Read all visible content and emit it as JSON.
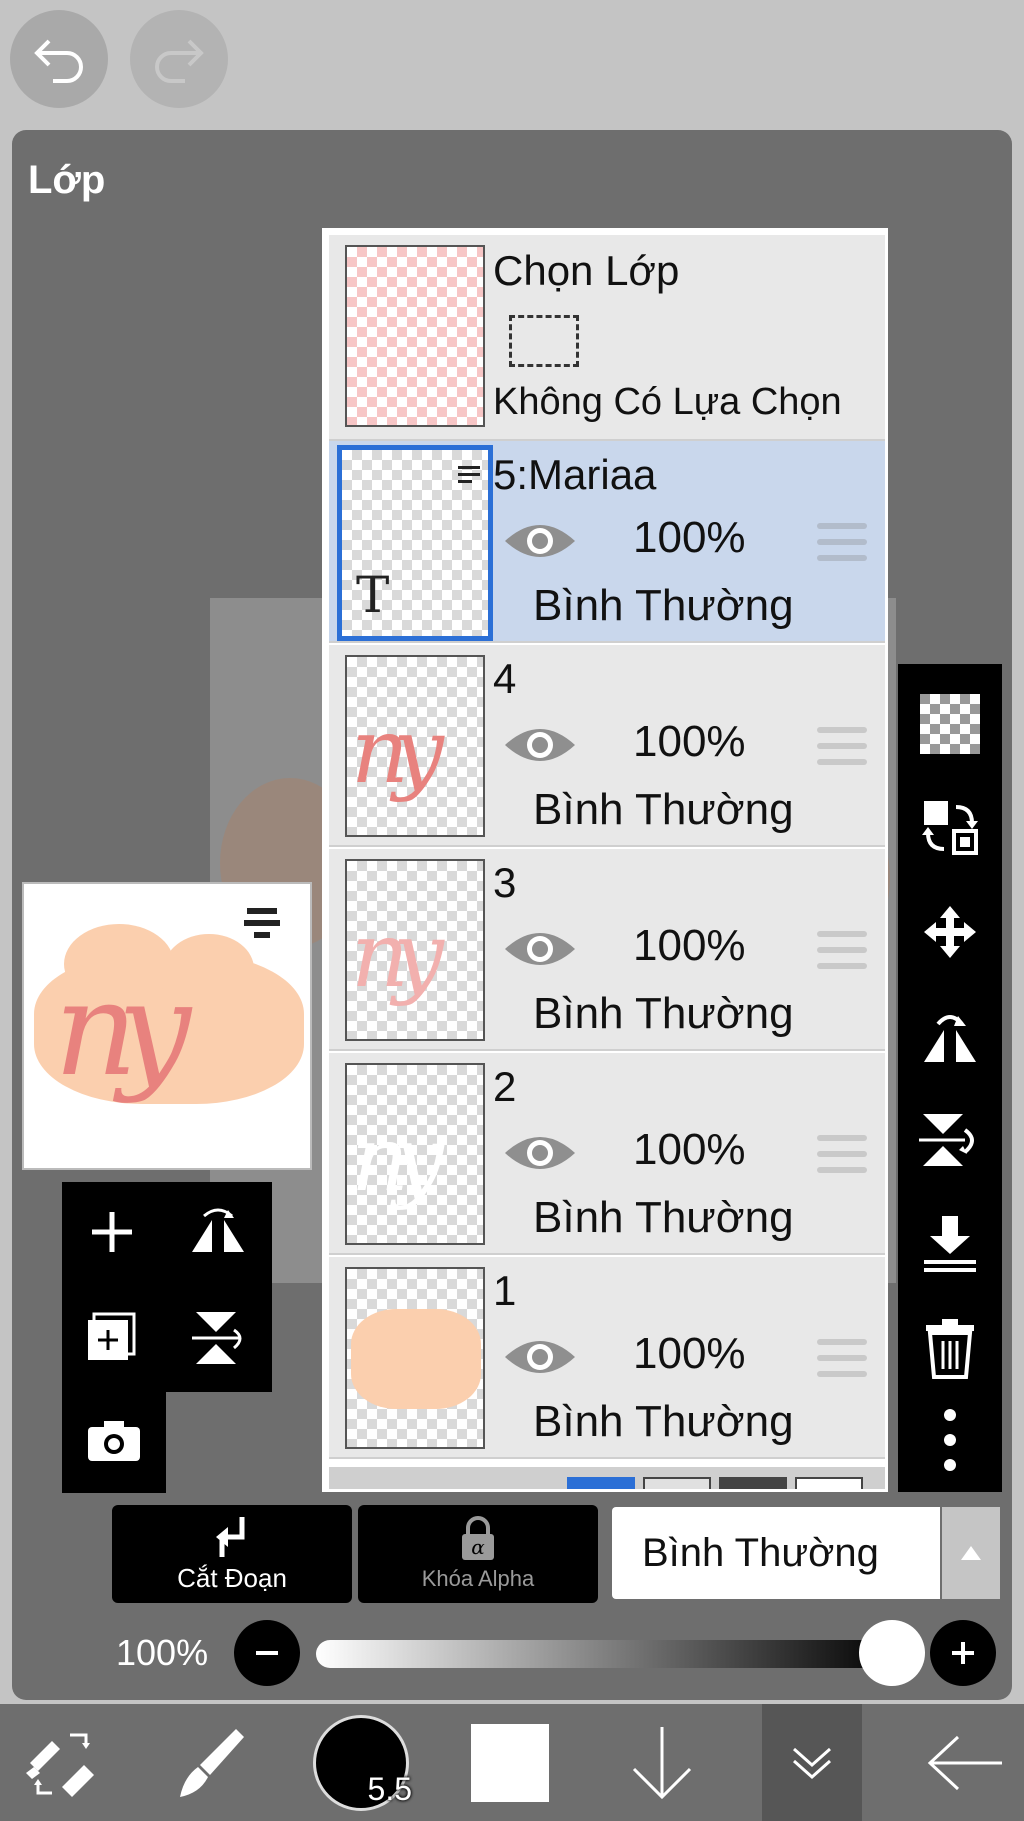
{
  "panel": {
    "title": "Lớp"
  },
  "layer_panel": {
    "selection": {
      "title": "Chọn Lớp",
      "subtitle": "Không Có Lựa Chọn"
    },
    "layers": [
      {
        "name": "5:Mariaa",
        "opacity": "100%",
        "blend": "Bình Thường",
        "selected": true,
        "visible": true,
        "type": "text"
      },
      {
        "name": "4",
        "opacity": "100%",
        "blend": "Bình Thường",
        "selected": false,
        "visible": true
      },
      {
        "name": "3",
        "opacity": "100%",
        "blend": "Bình Thường",
        "selected": false,
        "visible": true
      },
      {
        "name": "2",
        "opacity": "100%",
        "blend": "Bình Thường",
        "selected": false,
        "visible": true
      },
      {
        "name": "1",
        "opacity": "100%",
        "blend": "Bình Thường",
        "selected": false,
        "visible": true
      }
    ]
  },
  "controls": {
    "clip_label": "Cắt Đoạn",
    "alpha_lock_label": "Khóa Alpha",
    "blend_mode": "Bình Thường",
    "opacity_label": "100%",
    "opacity_value": 1.0
  },
  "toolbar": {
    "brush_size": "5.5"
  },
  "colors": {
    "accent": "#2b6fd6",
    "selected_row": "#c9d7ec",
    "panel_bg": "#6e6e6e",
    "peach": "#fbcfae",
    "pink": "#e8827e"
  }
}
